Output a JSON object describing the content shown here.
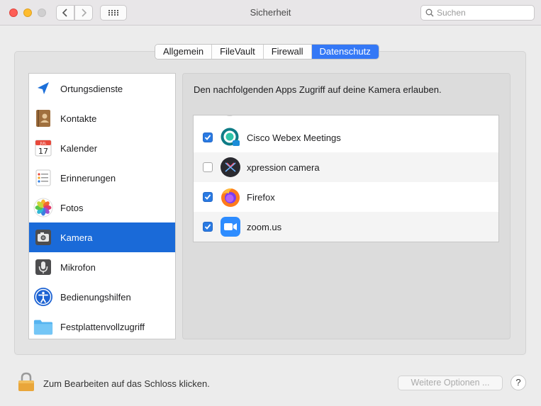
{
  "window": {
    "title": "Sicherheit"
  },
  "search": {
    "placeholder": "Suchen"
  },
  "tabs": [
    {
      "label": "Allgemein",
      "active": false
    },
    {
      "label": "FileVault",
      "active": false
    },
    {
      "label": "Firewall",
      "active": false
    },
    {
      "label": "Datenschutz",
      "active": true
    }
  ],
  "sidebar": {
    "selected": "Kamera",
    "items": [
      {
        "label": "Ortungsdienste",
        "icon": "location-arrow-icon"
      },
      {
        "label": "Kontakte",
        "icon": "contacts-book-icon"
      },
      {
        "label": "Kalender",
        "icon": "calendar-icon",
        "icon_text": {
          "month": "JUL",
          "day": "17"
        }
      },
      {
        "label": "Erinnerungen",
        "icon": "reminders-icon"
      },
      {
        "label": "Fotos",
        "icon": "photos-icon"
      },
      {
        "label": "Kamera",
        "icon": "camera-icon"
      },
      {
        "label": "Mikrofon",
        "icon": "microphone-icon"
      },
      {
        "label": "Bedienungshilfen",
        "icon": "accessibility-icon"
      },
      {
        "label": "Festplattenvollzugriff",
        "icon": "folder-icon"
      }
    ]
  },
  "content": {
    "description": "Den nachfolgenden Apps Zugriff auf deine Kamera erlauben.",
    "apps": [
      {
        "name": "Cisco Webex Meetings",
        "checked": true,
        "icon": "webex-icon"
      },
      {
        "name": "xpression camera",
        "checked": false,
        "icon": "xpression-icon"
      },
      {
        "name": "Firefox",
        "checked": true,
        "icon": "firefox-icon"
      },
      {
        "name": "zoom.us",
        "checked": true,
        "icon": "zoom-icon"
      }
    ]
  },
  "footer": {
    "lock_text": "Zum Bearbeiten auf das Schloss klicken.",
    "more_options": "Weitere Optionen ...",
    "help": "?"
  },
  "colors": {
    "accent": "#3478f6",
    "selection": "#1a6ad8",
    "checkbox": "#2a7ae2"
  }
}
